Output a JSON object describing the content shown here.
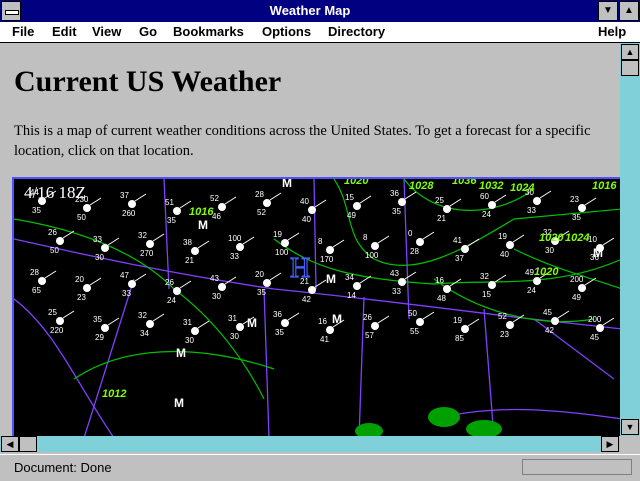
{
  "window": {
    "title": "Weather Map",
    "minimize_glyph": "▼",
    "maximize_glyph": "▲"
  },
  "menu": {
    "items": [
      "File",
      "Edit",
      "View",
      "Go",
      "Bookmarks",
      "Options",
      "Directory"
    ],
    "help": "Help"
  },
  "page": {
    "heading": "Current US Weather",
    "paragraph": "This is a map of current weather conditions across the United States. To get a forecast for a specific location, click on that location."
  },
  "map": {
    "timestamp": "4/16 18Z",
    "isobar_labels": [
      "1020",
      "1028",
      "1036",
      "1032",
      "1024",
      "1016",
      "1016",
      "1020",
      "1024",
      "1020",
      "1012"
    ],
    "pressure_center": "H",
    "front_markers": [
      "M",
      "M",
      "M",
      "M",
      "M",
      "M",
      "M",
      "M"
    ],
    "station_values": [
      "44",
      "35",
      "230",
      "50",
      "37",
      "260",
      "51",
      "35",
      "52",
      "46",
      "28",
      "52",
      "40",
      "40",
      "15",
      "49",
      "36",
      "35",
      "25",
      "21",
      "60",
      "24",
      "30",
      "33",
      "23",
      "35",
      "26",
      "50",
      "33",
      "30",
      "32",
      "270",
      "38",
      "21",
      "100",
      "33",
      "19",
      "100",
      "8",
      "170",
      "8",
      "100",
      "0",
      "28",
      "41",
      "37",
      "19",
      "40",
      "32",
      "30",
      "10",
      "36",
      "28",
      "65",
      "20",
      "23",
      "47",
      "33",
      "26",
      "24",
      "43",
      "30",
      "20",
      "35",
      "21",
      "42",
      "34",
      "14",
      "43",
      "33",
      "16",
      "48",
      "32",
      "15",
      "49",
      "24",
      "200",
      "49",
      "25",
      "220",
      "35",
      "29",
      "32",
      "34",
      "31",
      "30",
      "31",
      "30",
      "36",
      "35",
      "16",
      "41",
      "26",
      "57",
      "50",
      "55",
      "19",
      "85",
      "52",
      "23",
      "45",
      "42",
      "200",
      "45"
    ],
    "colors": {
      "background": "#000000",
      "isobar": "#00c000",
      "boundary": "#8040ff",
      "label": "#80ff00"
    }
  },
  "status": {
    "text": "Document: Done"
  }
}
